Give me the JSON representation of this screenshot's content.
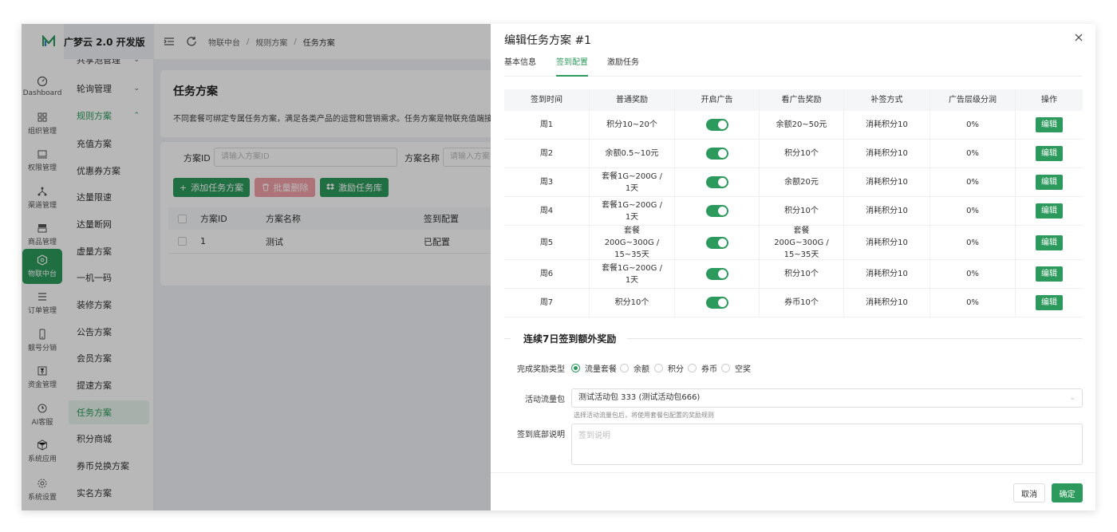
{
  "app": {
    "title": "广梦云 2.0 开发版"
  },
  "rail": [
    {
      "label": "Dashboard",
      "icon": "dashboard-icon"
    },
    {
      "label": "组织管理",
      "icon": "org-icon"
    },
    {
      "label": "权限管理",
      "icon": "permission-icon"
    },
    {
      "label": "渠道管理",
      "icon": "channel-icon"
    },
    {
      "label": "商品管理",
      "icon": "product-icon"
    },
    {
      "label": "物联中台",
      "icon": "iot-icon"
    },
    {
      "label": "订单管理",
      "icon": "order-icon"
    },
    {
      "label": "靓号分销",
      "icon": "phone-icon"
    },
    {
      "label": "资金管理",
      "icon": "finance-icon"
    },
    {
      "label": "AI客服",
      "icon": "ai-service-icon"
    },
    {
      "label": "系统应用",
      "icon": "app-icon"
    },
    {
      "label": "系统设置",
      "icon": "settings-icon"
    }
  ],
  "submenu": [
    {
      "label": "共享池管理"
    },
    {
      "label": "轮询管理"
    },
    {
      "label": "规则方案"
    },
    {
      "label": "充值方案"
    },
    {
      "label": "优惠券方案"
    },
    {
      "label": "达量限速"
    },
    {
      "label": "达量断网"
    },
    {
      "label": "虚量方案"
    },
    {
      "label": "一机一码"
    },
    {
      "label": "装修方案"
    },
    {
      "label": "公告方案"
    },
    {
      "label": "会员方案"
    },
    {
      "label": "提速方案"
    },
    {
      "label": "任务方案"
    },
    {
      "label": "积分商城"
    },
    {
      "label": "券币兑换方案"
    },
    {
      "label": "实名方案"
    }
  ],
  "breadcrumb": [
    "物联中台",
    "规则方案",
    "任务方案"
  ],
  "page": {
    "title": "任务方案",
    "description": "不同套餐可绑定专属任务方案，满足各类产品的运营和营销需求。任务方案是物联充值端接入",
    "filter_id_label": "方案ID",
    "filter_id_placeholder": "请输入方案ID",
    "filter_name_label": "方案名称",
    "filter_name_placeholder": "请输入方案名",
    "btn_add": "添加任务方案",
    "btn_batch_delete": "批量删除",
    "btn_library": "激励任务库",
    "table_headers": [
      "方案ID",
      "方案名称",
      "签到配置"
    ],
    "table_rows": [
      [
        "1",
        "测试",
        "已配置"
      ]
    ]
  },
  "drawer": {
    "title": "编辑任务方案 #1",
    "tabs": [
      "基本信息",
      "签到配置",
      "激励任务"
    ],
    "active_tab": "签到配置",
    "grid_headers": [
      "签到时间",
      "普通奖励",
      "开启广告",
      "看广告奖励",
      "补签方式",
      "广告层级分润",
      "操作"
    ],
    "grid_rows": [
      {
        "day": "周1",
        "reward": "积分10~20个",
        "ad_on": true,
        "ad_reward": "余额20~50元",
        "makeup": "消耗积分10",
        "share": "0%",
        "action": "编辑"
      },
      {
        "day": "周2",
        "reward": "余额0.5~10元",
        "ad_on": true,
        "ad_reward": "积分10个",
        "makeup": "消耗积分10",
        "share": "0%",
        "action": "编辑"
      },
      {
        "day": "周3",
        "reward": "套餐1G~200G / 1天",
        "ad_on": true,
        "ad_reward": "余额20元",
        "makeup": "消耗积分10",
        "share": "0%",
        "action": "编辑"
      },
      {
        "day": "周4",
        "reward": "套餐1G~200G / 1天",
        "ad_on": true,
        "ad_reward": "积分10个",
        "makeup": "消耗积分10",
        "share": "0%",
        "action": "编辑"
      },
      {
        "day": "周5",
        "reward": "套餐200G~300G / 15~35天",
        "ad_on": true,
        "ad_reward": "套餐200G~300G / 15~35天",
        "makeup": "消耗积分10",
        "share": "0%",
        "action": "编辑"
      },
      {
        "day": "周6",
        "reward": "套餐1G~200G / 1天",
        "ad_on": true,
        "ad_reward": "积分10个",
        "makeup": "消耗积分10",
        "share": "0%",
        "action": "编辑"
      },
      {
        "day": "周7",
        "reward": "积分10个",
        "ad_on": true,
        "ad_reward": "券币10个",
        "makeup": "消耗积分10",
        "share": "0%",
        "action": "编辑"
      }
    ],
    "section_title": "连续7日签到额外奖励",
    "reward_type_label": "完成奖励类型",
    "reward_types": [
      "流量套餐",
      "余额",
      "积分",
      "券币",
      "空奖"
    ],
    "reward_type_selected": "流量套餐",
    "package_label": "活动流量包",
    "package_value": "测试活动包 333 (测试活动包666)",
    "package_hint": "选择活动流量包后，将使用套餐包配置的奖励规则",
    "desc_label": "签到底部说明",
    "desc_placeholder": "签到说明",
    "cancel": "取消",
    "confirm": "确定"
  },
  "colors": {
    "accent": "#2b9a5c",
    "danger_light": "#f29fa8"
  }
}
